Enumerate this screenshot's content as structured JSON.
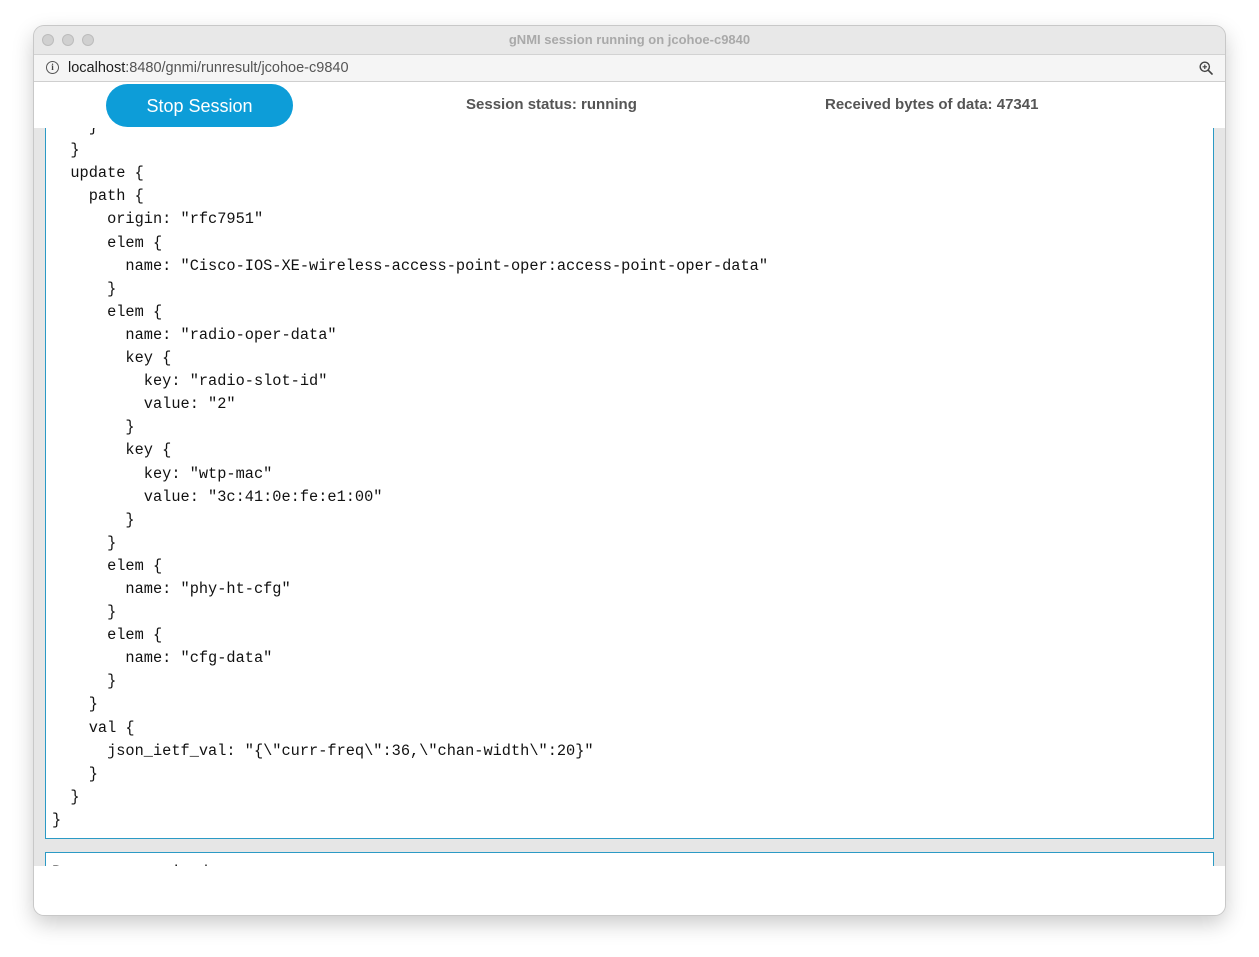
{
  "window": {
    "title": "gNMI session running on jcohoe-c9840"
  },
  "address_bar": {
    "url_host": "localhost",
    "url_path": ":8480/gnmi/runresult/jcohoe-c9840",
    "info_icon": "info-icon",
    "zoom_icon": "zoom-icon"
  },
  "toolbar": {
    "stop_label": "Stop Session",
    "status_text": "Session status: running",
    "bytes_text": "Received bytes of data: 47341"
  },
  "output": {
    "lines": [
      "    }",
      "  }",
      "  update {",
      "    path {",
      "      origin: \"rfc7951\"",
      "      elem {",
      "        name: \"Cisco-IOS-XE-wireless-access-point-oper:access-point-oper-data\"",
      "      }",
      "      elem {",
      "        name: \"radio-oper-data\"",
      "        key {",
      "          key: \"radio-slot-id\"",
      "          value: \"2\"",
      "        }",
      "        key {",
      "          key: \"wtp-mac\"",
      "          value: \"3c:41:0e:fe:e1:00\"",
      "        }",
      "      }",
      "      elem {",
      "        name: \"phy-ht-cfg\"",
      "      }",
      "      elem {",
      "        name: \"cfg-data\"",
      "      }",
      "    }",
      "    val {",
      "      json_ietf_val: \"{\\\"curr-freq\\\":36,\\\"chan-width\\\":20}\"",
      "    }",
      "  }",
      "}"
    ],
    "next_block_partial": "Response received"
  },
  "colors": {
    "accent": "#0d9dd8",
    "border": "#2b9ac5",
    "status_text": "#555555"
  }
}
